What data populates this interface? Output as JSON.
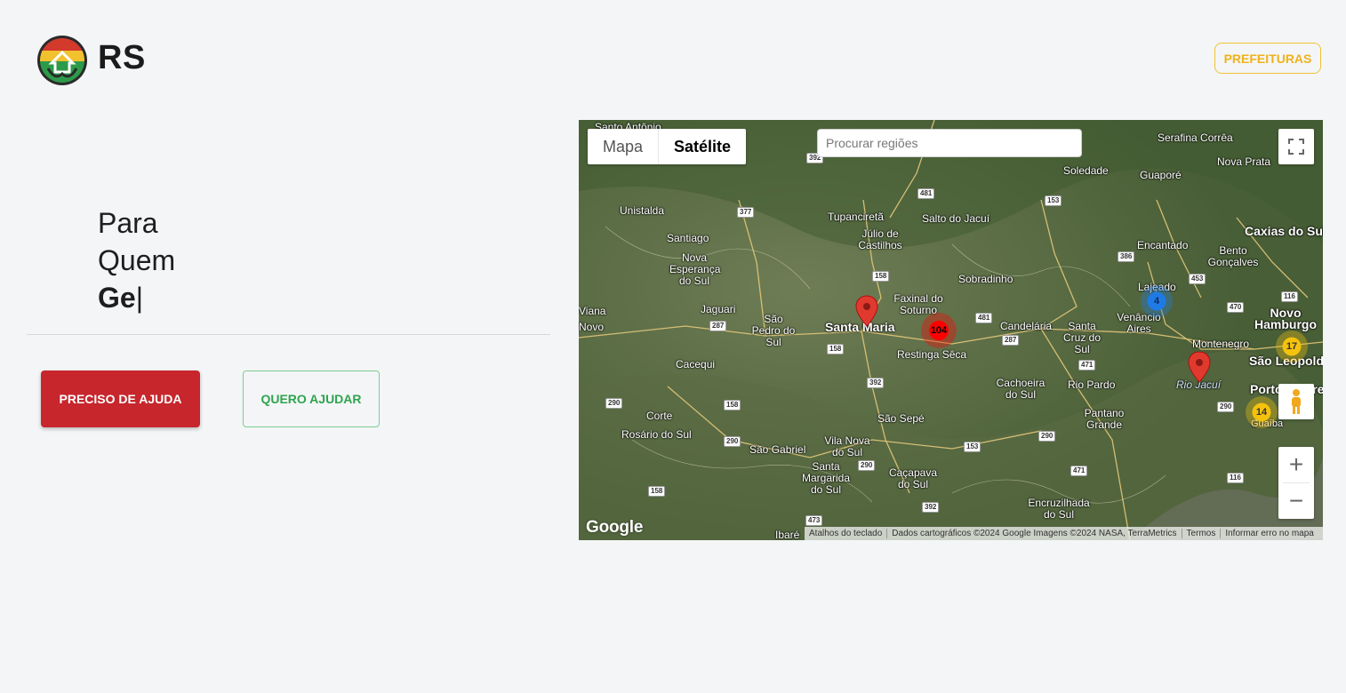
{
  "header": {
    "brand": "RS",
    "prefeituras_label": "PREFEITURAS"
  },
  "hero": {
    "line1": "Para",
    "line2": "Quem",
    "line3_typed": "Ge",
    "caret": "|"
  },
  "actions": {
    "need_help_label": "PRECISO DE AJUDA",
    "want_help_label": "QUERO AJUDAR"
  },
  "map": {
    "type_options": [
      "Mapa",
      "Satélite"
    ],
    "selected_type": "Satélite",
    "search_placeholder": "Procurar regiões",
    "google_logo": "Google",
    "attribution": [
      "Atalhos do teclado",
      "Dados cartográficos ©2024 Google Imagens ©2024 NASA, TerraMetrics",
      "Termos",
      "Informar erro no mapa"
    ],
    "clusters": [
      "104",
      "4",
      "17",
      "14"
    ],
    "place_labels": [
      "Santo Antônio",
      "Serafina Corrêa",
      "Nova Prata",
      "Soledade",
      "Guaporé",
      "Unistalda",
      "Tupanciretã",
      "Salto do Jacuí",
      "Júlio de Castilhos",
      "Santiago",
      "Encantado",
      "Caxias do Sul",
      "Bento Gonçalves",
      "Nova Esperança do Sul",
      "Sobradinho",
      "Lajeado",
      "Faxinal do Soturno",
      "Jaguari",
      "Venâncio Aires",
      "Novo Hamburgo",
      "São Pedro do Sul",
      "Santa Maria",
      "Candelária",
      "Santa Cruz do Sul",
      "Montenegro",
      "Restinga Sêca",
      "São Leopoldo",
      "Cacequi",
      "Cachoeira do Sul",
      "Rio Pardo",
      "Porto Alegre",
      "Corte",
      "Rosário do Sul",
      "São Sepé",
      "Pantano Grande",
      "Guaíba",
      "Vila Nova do Sul",
      "São Gabriel",
      "Santa Margarida do Sul",
      "Caçapava do Sul",
      "Encruzilhada do Sul",
      "Ibaré",
      "Viana",
      "Novo",
      "Rio Jacuí"
    ],
    "road_shields": [
      "392",
      "377",
      "481",
      "153",
      "386",
      "453",
      "158",
      "470",
      "116",
      "287",
      "481",
      "287",
      "158",
      "471",
      "392",
      "290",
      "158",
      "290",
      "290",
      "153",
      "290",
      "290",
      "116",
      "471",
      "158",
      "473",
      "392"
    ]
  }
}
